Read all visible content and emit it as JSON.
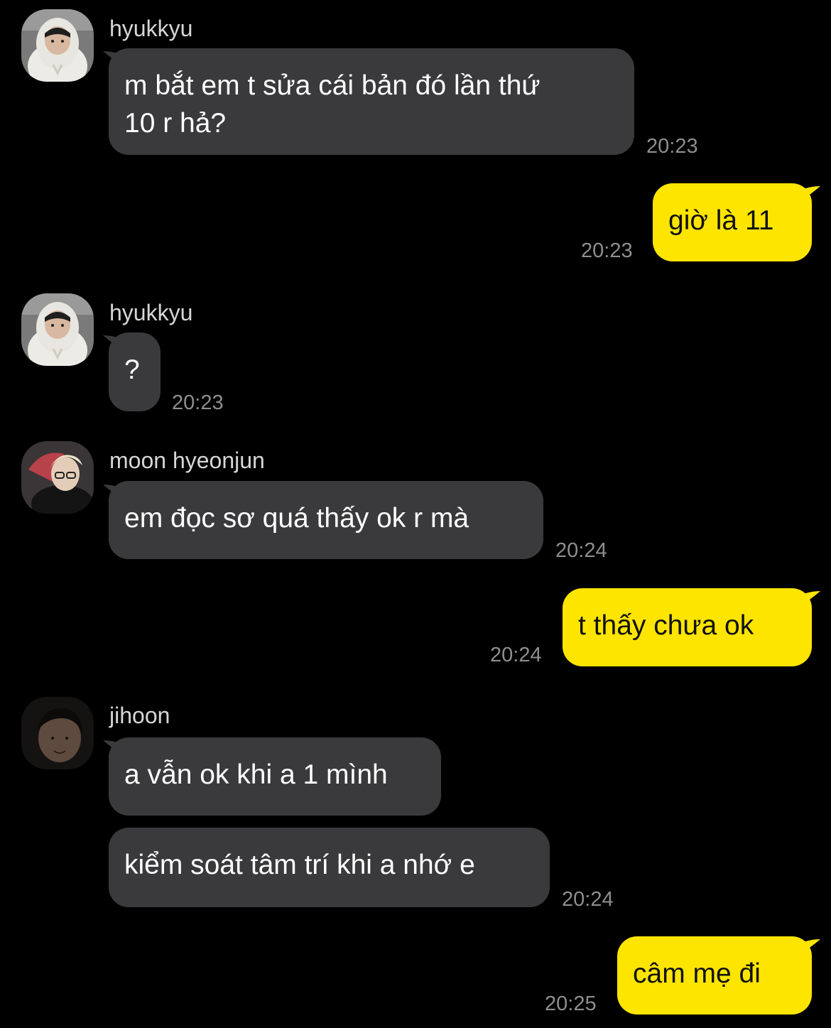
{
  "colors": {
    "background": "#000000",
    "incoming_bubble": "#3a3a3c",
    "outgoing_bubble": "#fee500",
    "timestamp": "#8e8e8e",
    "sender_name": "#d6d6d6"
  },
  "messages": [
    {
      "sender": "hyukkyu",
      "avatar": "avatar-hyukkyu-icon",
      "text": "m bắt em t sửa cái bản đó lần thứ\n10 r hả?",
      "time": "20:23"
    },
    {
      "sender": "me",
      "text": "giờ là 11",
      "time": "20:23"
    },
    {
      "sender": "hyukkyu",
      "avatar": "avatar-hyukkyu-icon",
      "text": "?",
      "time": "20:23"
    },
    {
      "sender": "moon hyeonjun",
      "avatar": "avatar-moon-hyeonjun-icon",
      "text": "em đọc sơ quá thấy ok r mà",
      "time": "20:24"
    },
    {
      "sender": "me",
      "text": "t thấy chưa ok",
      "time": "20:24"
    },
    {
      "sender": "jihoon",
      "avatar": "avatar-jihoon-icon",
      "text": "a vẫn ok khi a 1 mình",
      "time": ""
    },
    {
      "sender": "jihoon",
      "text": "kiểm soát tâm trí khi a nhớ e",
      "time": "20:24"
    },
    {
      "sender": "me",
      "text": "câm mẹ đi",
      "time": "20:25"
    }
  ]
}
